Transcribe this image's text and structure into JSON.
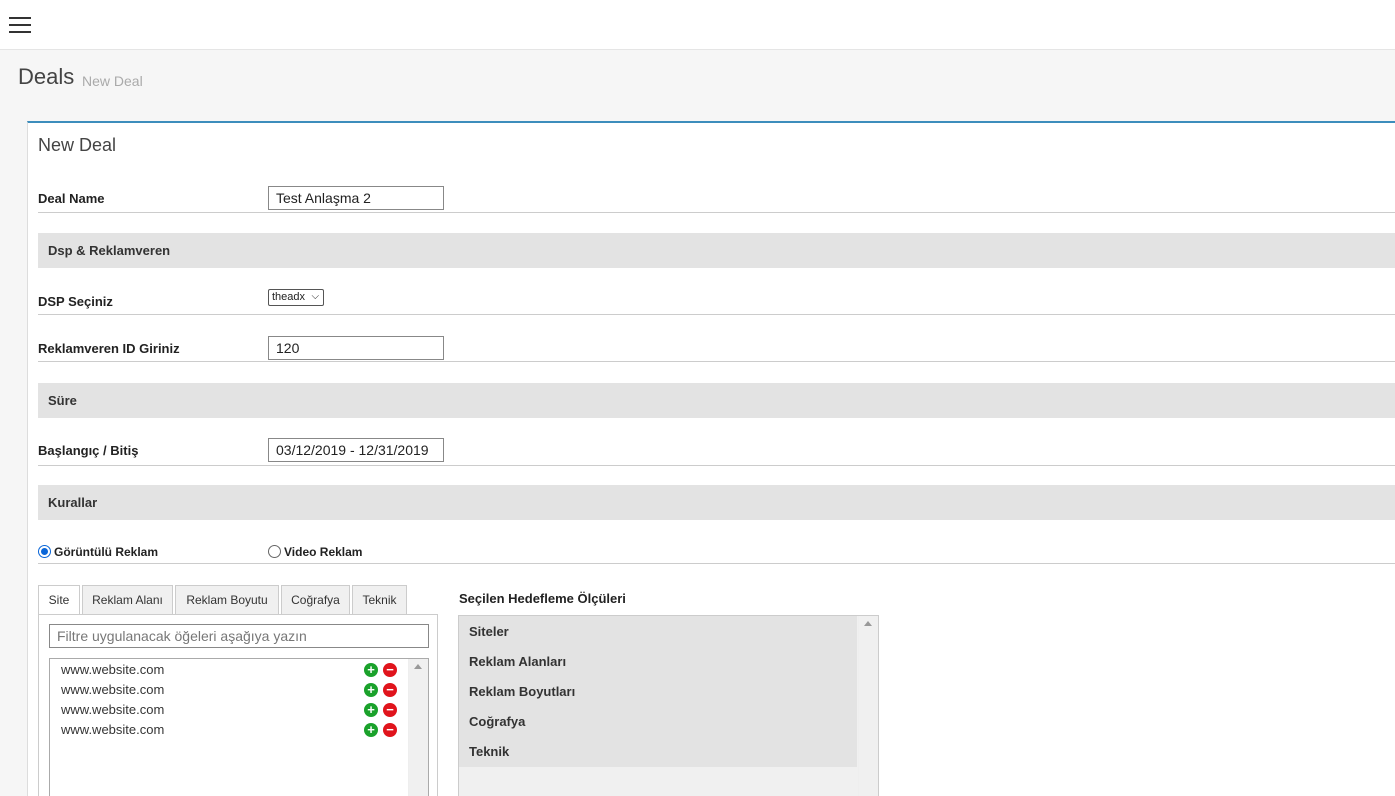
{
  "topbar": {
    "menu_icon": "hamburger-icon"
  },
  "header": {
    "title": "Deals",
    "subtitle": "New Deal"
  },
  "box": {
    "title": "New Deal"
  },
  "form": {
    "deal_name_label": "Deal Name",
    "deal_name_value": "Test Anlaşma 2",
    "dsp_section": "Dsp & Reklamveren",
    "dsp_label": "DSP Seçiniz",
    "dsp_selected": "theadx",
    "advertiser_label": "Reklamveren ID Giriniz",
    "advertiser_value": "120",
    "duration_section": "Süre",
    "date_label": "Başlangıç / Bitiş",
    "date_value": "03/12/2019 - 12/31/2019",
    "rules_section": "Kurallar",
    "radio_display": "Görüntülü Reklam",
    "radio_video": "Video Reklam"
  },
  "tabs": [
    "Site",
    "Reklam Alanı",
    "Reklam Boyutu",
    "Coğrafya",
    "Teknik"
  ],
  "filter": {
    "placeholder": "Filtre uygulanacak öğeleri aşağıya yazın"
  },
  "site_list": [
    "www.website.com",
    "www.website.com",
    "www.website.com",
    "www.website.com"
  ],
  "selected": {
    "title": "Seçilen Hedefleme Ölçüleri",
    "items": [
      "Siteler",
      "Reklam Alanları",
      "Reklam Boyutları",
      "Coğrafya",
      "Teknik"
    ]
  },
  "colors": {
    "accent": "#3c8dbc",
    "add": "#1aa12b",
    "remove": "#e0141c"
  }
}
